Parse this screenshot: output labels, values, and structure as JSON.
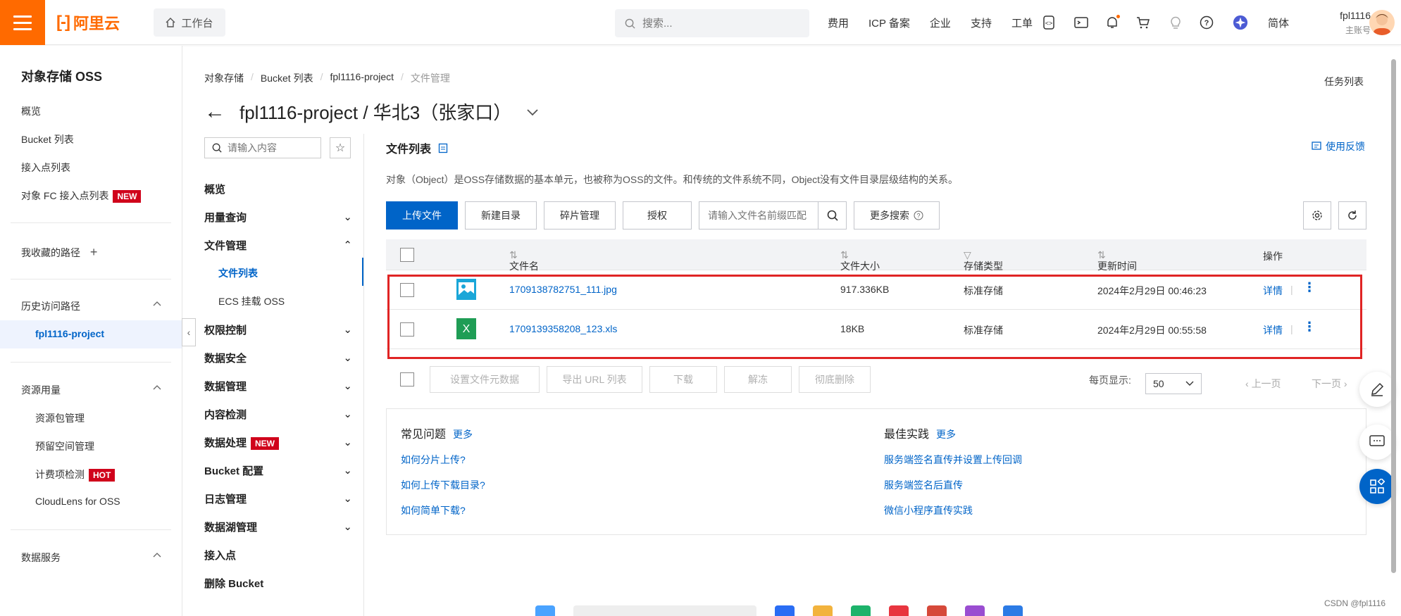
{
  "topbar": {
    "brand": "阿里云",
    "workbench": "工作台",
    "search_placeholder": "搜索...",
    "nav": [
      "费用",
      "ICP 备案",
      "企业",
      "支持",
      "工单"
    ],
    "lang": "简体",
    "user_name": "fpl1116",
    "user_role": "主账号"
  },
  "sidebar": {
    "title": "对象存储 OSS",
    "items": [
      "概览",
      "Bucket 列表",
      "接入点列表",
      "对象 FC 接入点列表"
    ],
    "new_badge": "NEW",
    "favorites": "我收藏的路径",
    "history": "历史访问路径",
    "history_active": "fpl1116-project",
    "resource_usage": "资源用量",
    "resource_items": [
      "资源包管理",
      "预留空间管理",
      "计费项检测",
      "CloudLens for OSS"
    ],
    "hot_badge": "HOT",
    "data_service": "数据服务"
  },
  "breadcrumb": [
    "对象存储",
    "Bucket 列表",
    "fpl1116-project",
    "文件管理"
  ],
  "task_list": "任务列表",
  "page_title": "fpl1116-project / 华北3（张家口）",
  "subnav": {
    "search_placeholder": "请输入内容",
    "items": {
      "overview": "概览",
      "usage": "用量查询",
      "file_mgmt": "文件管理",
      "file_list": "文件列表",
      "ecs_mount": "ECS 挂载 OSS",
      "permission": "权限控制",
      "data_security": "数据安全",
      "data_mgmt": "数据管理",
      "content_check": "内容检测",
      "data_process": "数据处理",
      "bucket_config": "Bucket 配置",
      "log_mgmt": "日志管理",
      "datalake": "数据湖管理",
      "access_point": "接入点",
      "delete_bucket": "删除 Bucket"
    },
    "new_badge": "NEW"
  },
  "content": {
    "title": "文件列表",
    "feedback": "使用反馈",
    "description": "对象（Object）是OSS存储数据的基本单元，也被称为OSS的文件。和传统的文件系统不同，Object没有文件目录层级结构的关系。",
    "toolbar": {
      "upload": "上传文件",
      "new_dir": "新建目录",
      "fragments": "碎片管理",
      "authorize": "授权",
      "search_placeholder": "请输入文件名前缀匹配",
      "more_search": "更多搜索"
    },
    "table": {
      "headers": [
        "文件名",
        "文件大小",
        "存储类型",
        "更新时间",
        "操作"
      ],
      "rows": [
        {
          "name": "1709138782751_111.jpg",
          "size": "917.336KB",
          "storage": "标准存储",
          "updated": "2024年2月29日 00:46:23",
          "action": "详情"
        },
        {
          "name": "1709139358208_123.xls",
          "size": "18KB",
          "storage": "标准存储",
          "updated": "2024年2月29日 00:55:58",
          "action": "详情"
        }
      ]
    },
    "bulk": [
      "设置文件元数据",
      "导出 URL 列表",
      "下载",
      "解冻",
      "彻底删除"
    ],
    "page_size_label": "每页显示:",
    "page_size": "50",
    "prev": "上一页",
    "next": "下一页",
    "faq": {
      "title": "常见问题",
      "more": "更多",
      "links": [
        "如何分片上传?",
        "如何上传下载目录?",
        "如何简单下载?"
      ]
    },
    "best": {
      "title": "最佳实践",
      "more": "更多",
      "links": [
        "服务端签名直传并设置上传回调",
        "服务端签名后直传",
        "微信小程序直传实践"
      ]
    }
  },
  "watermark": "CSDN @fpl1116",
  "colors": {
    "brand": "#ff6a00",
    "primary": "#0064c8",
    "highlight": "#e02424",
    "badge": "#d0021b"
  }
}
